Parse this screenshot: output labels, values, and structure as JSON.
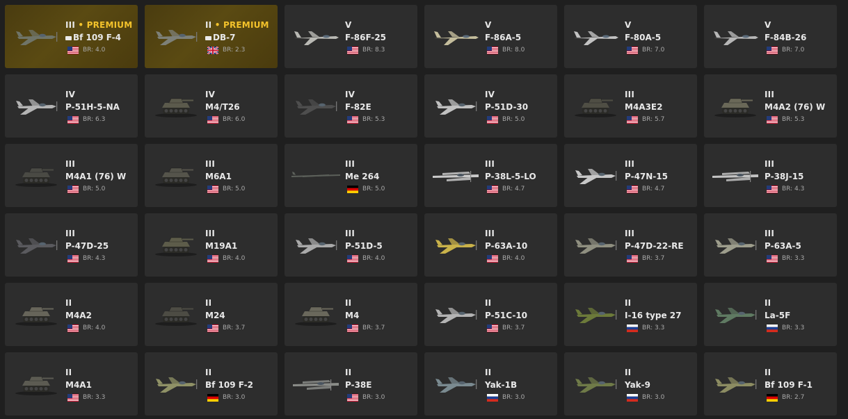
{
  "premium_label": "PREMIUM",
  "br_prefix": "BR:",
  "vehicles": [
    {
      "rank": "III",
      "premium": true,
      "tag": true,
      "name": "Bf 109 F-4",
      "flag": "usa",
      "br": "4.0",
      "kind": "plane",
      "color": "#6f7468"
    },
    {
      "rank": "II",
      "premium": true,
      "tag": true,
      "name": "DB-7",
      "flag": "uk",
      "br": "2.3",
      "kind": "plane",
      "color": "#7d8078"
    },
    {
      "rank": "V",
      "name": "F-86F-25",
      "flag": "usa",
      "br": "8.3",
      "kind": "jet",
      "color": "#b9b9b4"
    },
    {
      "rank": "V",
      "name": "F-86A-5",
      "flag": "usa",
      "br": "8.0",
      "kind": "jet",
      "color": "#c4bd9c"
    },
    {
      "rank": "V",
      "name": "F-80A-5",
      "flag": "usa",
      "br": "7.0",
      "kind": "jet",
      "color": "#c2c2c2"
    },
    {
      "rank": "V",
      "name": "F-84B-26",
      "flag": "usa",
      "br": "7.0",
      "kind": "jet",
      "color": "#b6b6b6"
    },
    {
      "rank": "IV",
      "name": "P-51H-5-NA",
      "flag": "usa",
      "br": "6.3",
      "kind": "plane",
      "color": "#b4b4b4"
    },
    {
      "rank": "IV",
      "name": "M4/T26",
      "flag": "usa",
      "br": "6.0",
      "kind": "tank",
      "color": "#5b5a4c"
    },
    {
      "rank": "IV",
      "name": "F-82E",
      "flag": "usa",
      "br": "5.3",
      "kind": "plane",
      "color": "#4e4e4e"
    },
    {
      "rank": "IV",
      "name": "P-51D-30",
      "flag": "usa",
      "br": "5.0",
      "kind": "plane",
      "color": "#c0c0c0"
    },
    {
      "rank": "III",
      "name": "M4A3E2",
      "flag": "usa",
      "br": "5.7",
      "kind": "tank",
      "color": "#4f4e44"
    },
    {
      "rank": "III",
      "name": "M4A2 (76) W",
      "flag": "usa",
      "br": "5.3",
      "kind": "tank",
      "color": "#6a6858"
    },
    {
      "rank": "III",
      "name": "M4A1 (76) W",
      "flag": "usa",
      "br": "5.0",
      "kind": "tank",
      "color": "#4a4a44"
    },
    {
      "rank": "III",
      "name": "M6A1",
      "flag": "usa",
      "br": "5.0",
      "kind": "tank",
      "color": "#55544b"
    },
    {
      "rank": "III",
      "name": "Me 264",
      "flag": "de",
      "br": "5.0",
      "kind": "bomber",
      "color": "#5c605a"
    },
    {
      "rank": "III",
      "name": "P-38L-5-LO",
      "flag": "usa",
      "br": "4.7",
      "kind": "twin",
      "color": "#c9c9c9"
    },
    {
      "rank": "III",
      "name": "P-47N-15",
      "flag": "usa",
      "br": "4.7",
      "kind": "plane",
      "color": "#c7c7c7"
    },
    {
      "rank": "III",
      "name": "P-38J-15",
      "flag": "usa",
      "br": "4.3",
      "kind": "twin",
      "color": "#c2c2c2"
    },
    {
      "rank": "III",
      "name": "P-47D-25",
      "flag": "usa",
      "br": "4.3",
      "kind": "plane",
      "color": "#5a5a5e"
    },
    {
      "rank": "III",
      "name": "M19A1",
      "flag": "usa",
      "br": "4.0",
      "kind": "tank",
      "color": "#5d5c4a"
    },
    {
      "rank": "III",
      "name": "P-51D-5",
      "flag": "usa",
      "br": "4.0",
      "kind": "plane",
      "color": "#a9a9a9"
    },
    {
      "rank": "III",
      "name": "P-63A-10",
      "flag": "usa",
      "br": "4.0",
      "kind": "plane",
      "color": "#c9b24a"
    },
    {
      "rank": "III",
      "name": "P-47D-22-RE",
      "flag": "usa",
      "br": "3.7",
      "kind": "plane",
      "color": "#8f8f80"
    },
    {
      "rank": "III",
      "name": "P-63A-5",
      "flag": "usa",
      "br": "3.3",
      "kind": "plane",
      "color": "#9d9d8c"
    },
    {
      "rank": "II",
      "name": "M4A2",
      "flag": "usa",
      "br": "4.0",
      "kind": "tank",
      "color": "#67655a"
    },
    {
      "rank": "II",
      "name": "M24",
      "flag": "usa",
      "br": "3.7",
      "kind": "tank",
      "color": "#4d4c44"
    },
    {
      "rank": "II",
      "name": "M4",
      "flag": "usa",
      "br": "3.7",
      "kind": "tank",
      "color": "#6a685c"
    },
    {
      "rank": "II",
      "name": "P-51C-10",
      "flag": "usa",
      "br": "3.7",
      "kind": "plane",
      "color": "#b3b3b3"
    },
    {
      "rank": "II",
      "name": "I-16 type 27",
      "flag": "ru",
      "br": "3.3",
      "kind": "plane",
      "color": "#6c7a3a"
    },
    {
      "rank": "II",
      "name": "La-5F",
      "flag": "ru",
      "br": "3.3",
      "kind": "plane",
      "color": "#5f7a62"
    },
    {
      "rank": "II",
      "name": "M4A1",
      "flag": "usa",
      "br": "3.3",
      "kind": "tank",
      "color": "#5c5b52"
    },
    {
      "rank": "II",
      "name": "Bf 109 F-2",
      "flag": "de",
      "br": "3.0",
      "kind": "plane",
      "color": "#8f9166"
    },
    {
      "rank": "II",
      "name": "P-38E",
      "flag": "usa",
      "br": "3.0",
      "kind": "twin",
      "color": "#8a8c88"
    },
    {
      "rank": "II",
      "name": "Yak-1B",
      "flag": "ru",
      "br": "3.0",
      "kind": "plane",
      "color": "#7a8a90"
    },
    {
      "rank": "II",
      "name": "Yak-9",
      "flag": "ru",
      "br": "3.0",
      "kind": "plane",
      "color": "#6f7a48"
    },
    {
      "rank": "II",
      "name": "Bf 109 F-1",
      "flag": "de",
      "br": "2.7",
      "kind": "plane",
      "color": "#8c8c62"
    }
  ]
}
